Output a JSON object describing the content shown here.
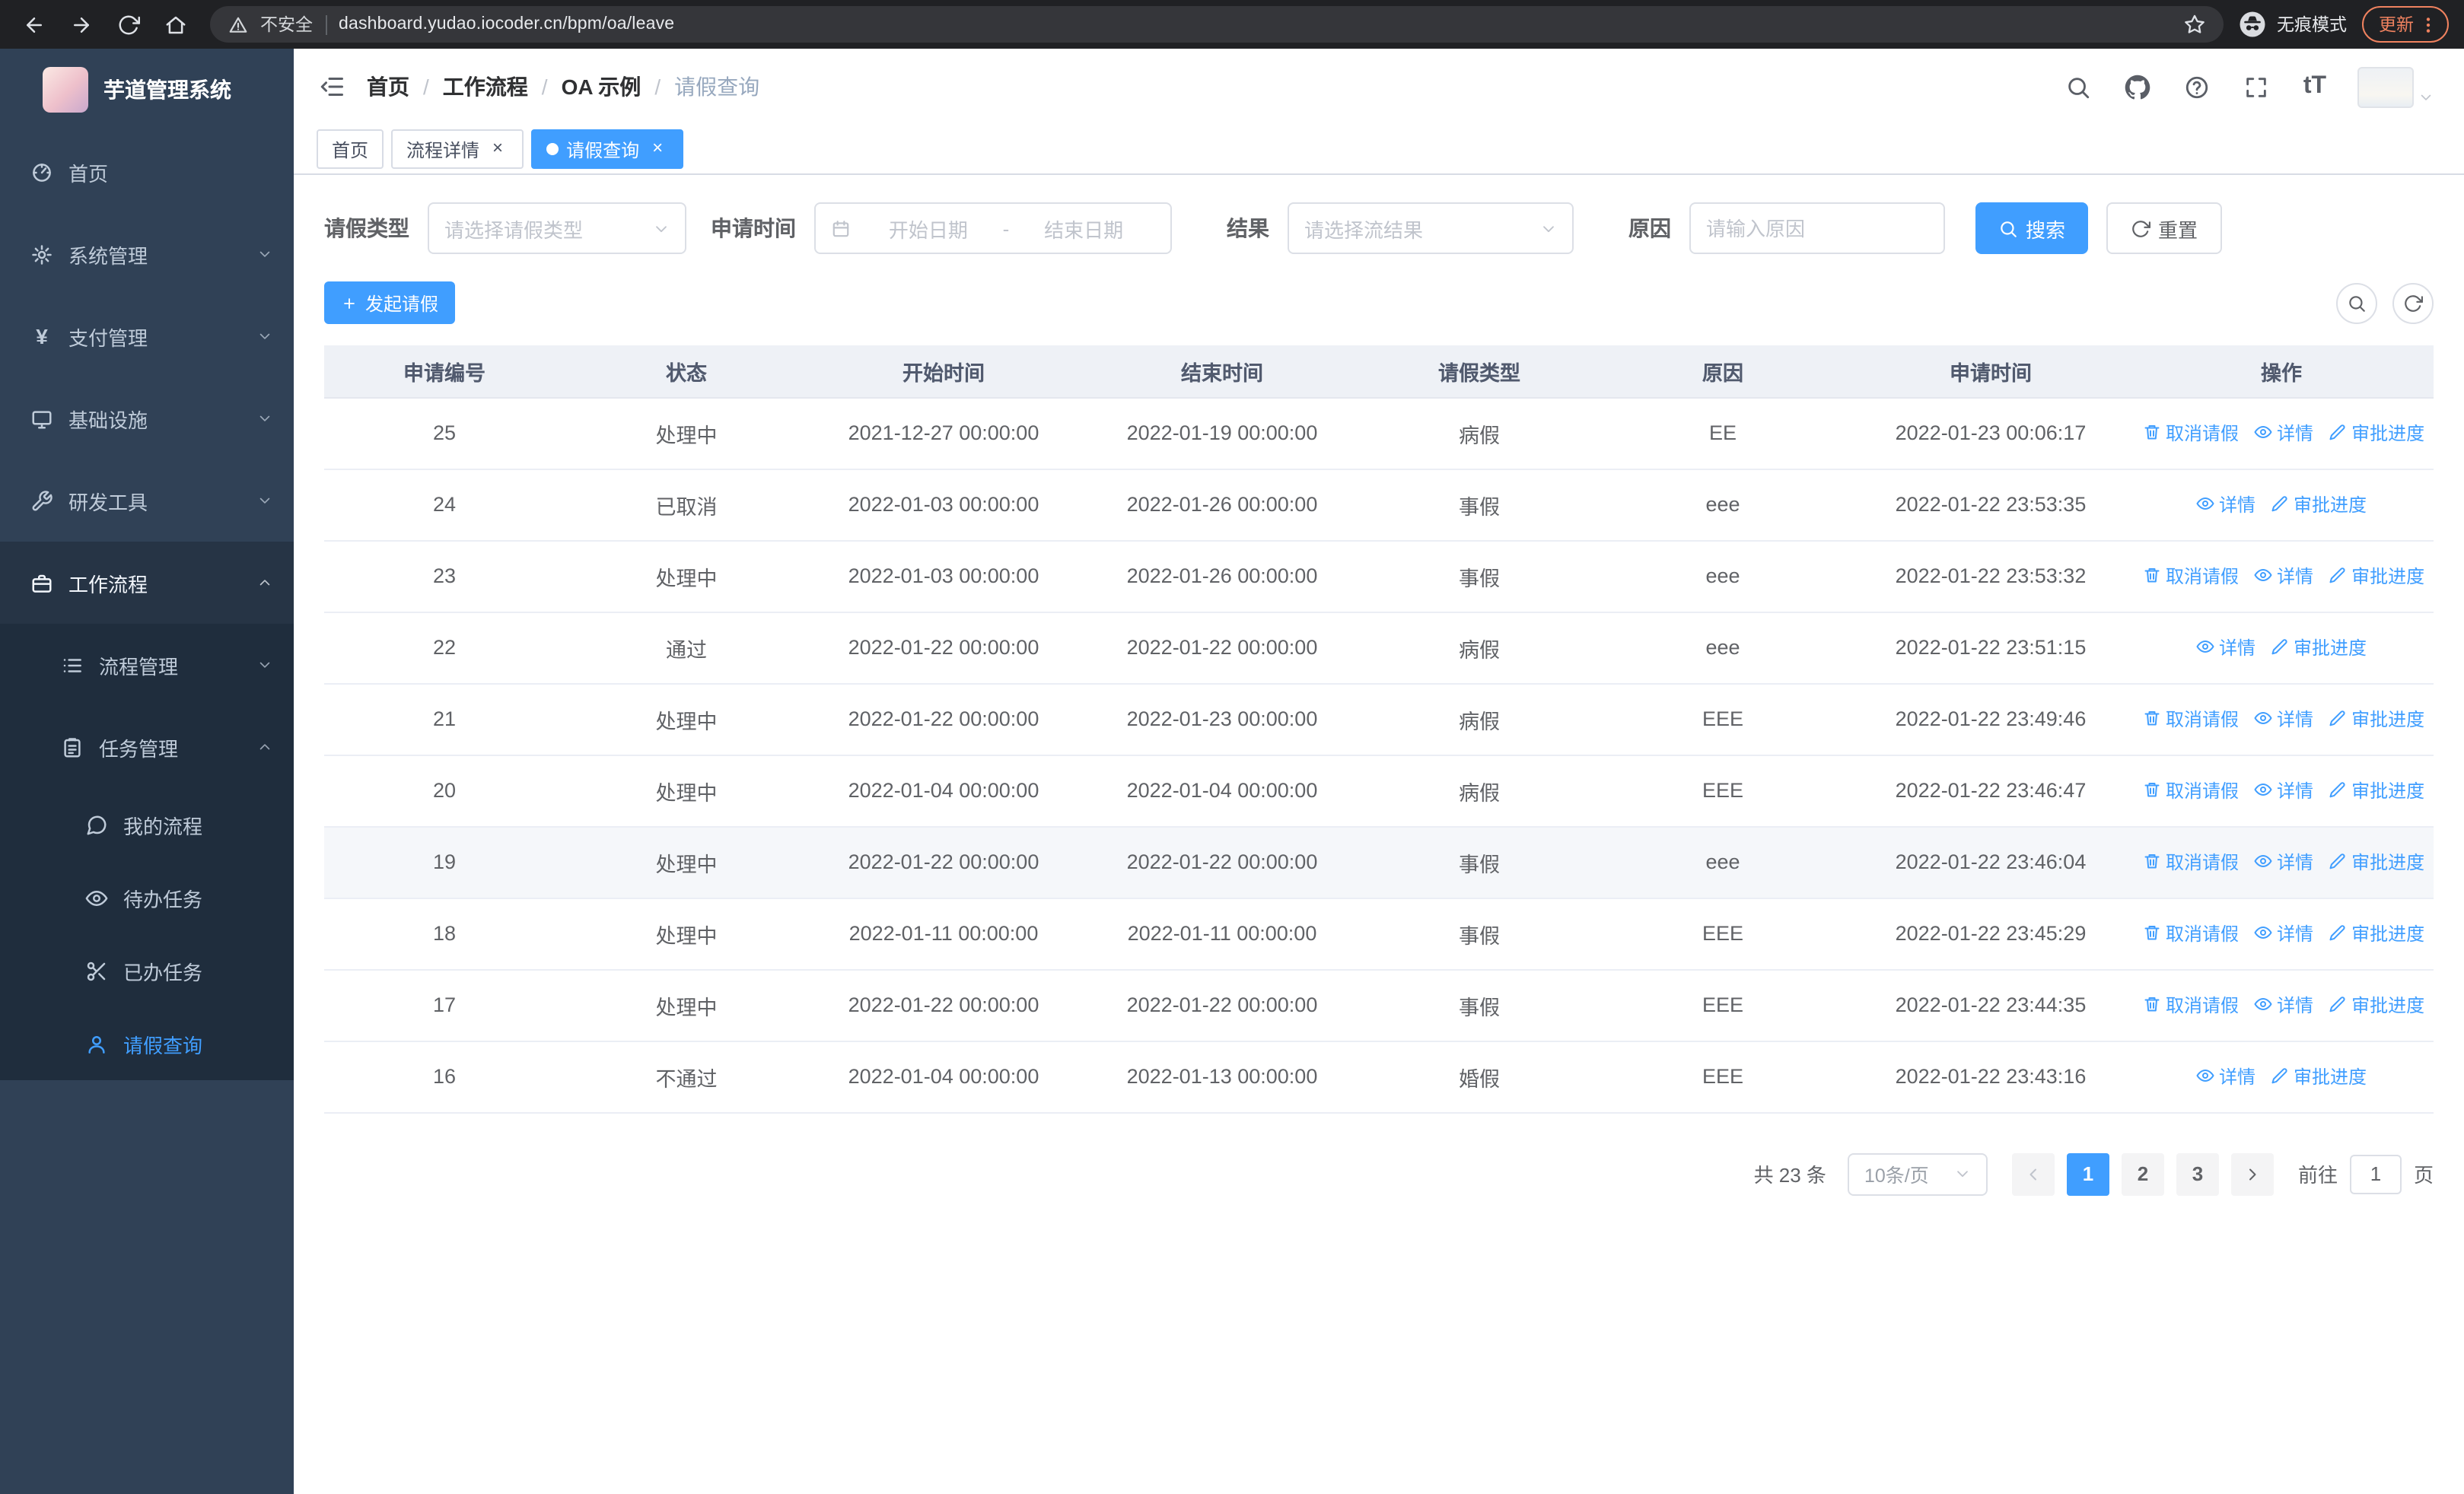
{
  "theme": {
    "primary_color": "#409eff",
    "sidebar_bg": "#304156",
    "sidebar_submenu_bg": "#1f2d3d"
  },
  "chrome": {
    "nav_icons": [
      "back",
      "forward",
      "refresh",
      "home"
    ],
    "security_label": "不安全",
    "url": "dashboard.yudao.iocoder.cn/bpm/oa/leave",
    "profile_label": "无痕模式",
    "update_label": "更新"
  },
  "sidebar": {
    "logo_title": "芋道管理系统",
    "items": [
      {
        "icon": "dashboard",
        "label": "首页",
        "level": 1
      },
      {
        "icon": "gear",
        "label": "系统管理",
        "level": 1,
        "chevron": "down"
      },
      {
        "icon": "yen",
        "label": "支付管理",
        "level": 1,
        "chevron": "down"
      },
      {
        "icon": "monitor",
        "label": "基础设施",
        "level": 1,
        "chevron": "down"
      },
      {
        "icon": "tool",
        "label": "研发工具",
        "level": 1,
        "chevron": "down"
      },
      {
        "icon": "briefcase",
        "label": "工作流程",
        "level": 1,
        "chevron": "up",
        "highlight": true
      },
      {
        "icon": "list",
        "label": "流程管理",
        "level": 2,
        "chevron": "down"
      },
      {
        "icon": "tasks",
        "label": "任务管理",
        "level": 2,
        "chevron": "up"
      },
      {
        "icon": "chat",
        "label": "我的流程",
        "level": 3
      },
      {
        "icon": "eye",
        "label": "待办任务",
        "level": 3
      },
      {
        "icon": "scissors",
        "label": "已办任务",
        "level": 3
      },
      {
        "icon": "user",
        "label": "请假查询",
        "level": 3,
        "active": true
      }
    ]
  },
  "header": {
    "breadcrumb": [
      "首页",
      "工作流程",
      "OA 示例",
      "请假查询"
    ],
    "action_icons": [
      "search",
      "github",
      "help",
      "fullscreen",
      "font-size"
    ]
  },
  "tabs": [
    {
      "label": "首页",
      "closable": false,
      "active": false
    },
    {
      "label": "流程详情",
      "closable": true,
      "active": false
    },
    {
      "label": "请假查询",
      "closable": true,
      "active": true
    }
  ],
  "filters": {
    "leave_type_label": "请假类型",
    "leave_type_placeholder": "请选择请假类型",
    "apply_time_label": "申请时间",
    "date_start_placeholder": "开始日期",
    "date_separator": "-",
    "date_end_placeholder": "结束日期",
    "result_label": "结果",
    "result_placeholder": "请选择流结果",
    "reason_label": "原因",
    "reason_placeholder": "请输入原因",
    "search_button": "搜索",
    "reset_button": "重置"
  },
  "toolbar": {
    "create_button": "发起请假",
    "icon_buttons": [
      "search",
      "refresh"
    ]
  },
  "table": {
    "columns": [
      "申请编号",
      "状态",
      "开始时间",
      "结束时间",
      "请假类型",
      "原因",
      "申请时间",
      "操作"
    ],
    "action_labels": {
      "cancel": "取消请假",
      "detail": "详情",
      "progress": "审批进度"
    },
    "rows": [
      {
        "id": "25",
        "status": "处理中",
        "start": "2021-12-27 00:00:00",
        "end": "2022-01-19 00:00:00",
        "type": "病假",
        "reason": "EE",
        "apply_time": "2022-01-23 00:06:17",
        "actions": [
          "cancel",
          "detail",
          "progress"
        ]
      },
      {
        "id": "24",
        "status": "已取消",
        "start": "2022-01-03 00:00:00",
        "end": "2022-01-26 00:00:00",
        "type": "事假",
        "reason": "eee",
        "apply_time": "2022-01-22 23:53:35",
        "actions": [
          "detail",
          "progress"
        ]
      },
      {
        "id": "23",
        "status": "处理中",
        "start": "2022-01-03 00:00:00",
        "end": "2022-01-26 00:00:00",
        "type": "事假",
        "reason": "eee",
        "apply_time": "2022-01-22 23:53:32",
        "actions": [
          "cancel",
          "detail",
          "progress"
        ]
      },
      {
        "id": "22",
        "status": "通过",
        "start": "2022-01-22 00:00:00",
        "end": "2022-01-22 00:00:00",
        "type": "病假",
        "reason": "eee",
        "apply_time": "2022-01-22 23:51:15",
        "actions": [
          "detail",
          "progress"
        ]
      },
      {
        "id": "21",
        "status": "处理中",
        "start": "2022-01-22 00:00:00",
        "end": "2022-01-23 00:00:00",
        "type": "病假",
        "reason": "EEE",
        "apply_time": "2022-01-22 23:49:46",
        "actions": [
          "cancel",
          "detail",
          "progress"
        ]
      },
      {
        "id": "20",
        "status": "处理中",
        "start": "2022-01-04 00:00:00",
        "end": "2022-01-04 00:00:00",
        "type": "病假",
        "reason": "EEE",
        "apply_time": "2022-01-22 23:46:47",
        "actions": [
          "cancel",
          "detail",
          "progress"
        ]
      },
      {
        "id": "19",
        "status": "处理中",
        "start": "2022-01-22 00:00:00",
        "end": "2022-01-22 00:00:00",
        "type": "事假",
        "reason": "eee",
        "apply_time": "2022-01-22 23:46:04",
        "actions": [
          "cancel",
          "detail",
          "progress"
        ],
        "hover": true
      },
      {
        "id": "18",
        "status": "处理中",
        "start": "2022-01-11 00:00:00",
        "end": "2022-01-11 00:00:00",
        "type": "事假",
        "reason": "EEE",
        "apply_time": "2022-01-22 23:45:29",
        "actions": [
          "cancel",
          "detail",
          "progress"
        ]
      },
      {
        "id": "17",
        "status": "处理中",
        "start": "2022-01-22 00:00:00",
        "end": "2022-01-22 00:00:00",
        "type": "事假",
        "reason": "EEE",
        "apply_time": "2022-01-22 23:44:35",
        "actions": [
          "cancel",
          "detail",
          "progress"
        ]
      },
      {
        "id": "16",
        "status": "不通过",
        "start": "2022-01-04 00:00:00",
        "end": "2022-01-13 00:00:00",
        "type": "婚假",
        "reason": "EEE",
        "apply_time": "2022-01-22 23:43:16",
        "actions": [
          "detail",
          "progress"
        ]
      }
    ]
  },
  "pagination": {
    "total_text": "共 23 条",
    "page_size": "10条/页",
    "pages": [
      "1",
      "2",
      "3"
    ],
    "current_page": "1",
    "goto_label": "前往",
    "goto_value": "1",
    "goto_suffix": "页"
  }
}
